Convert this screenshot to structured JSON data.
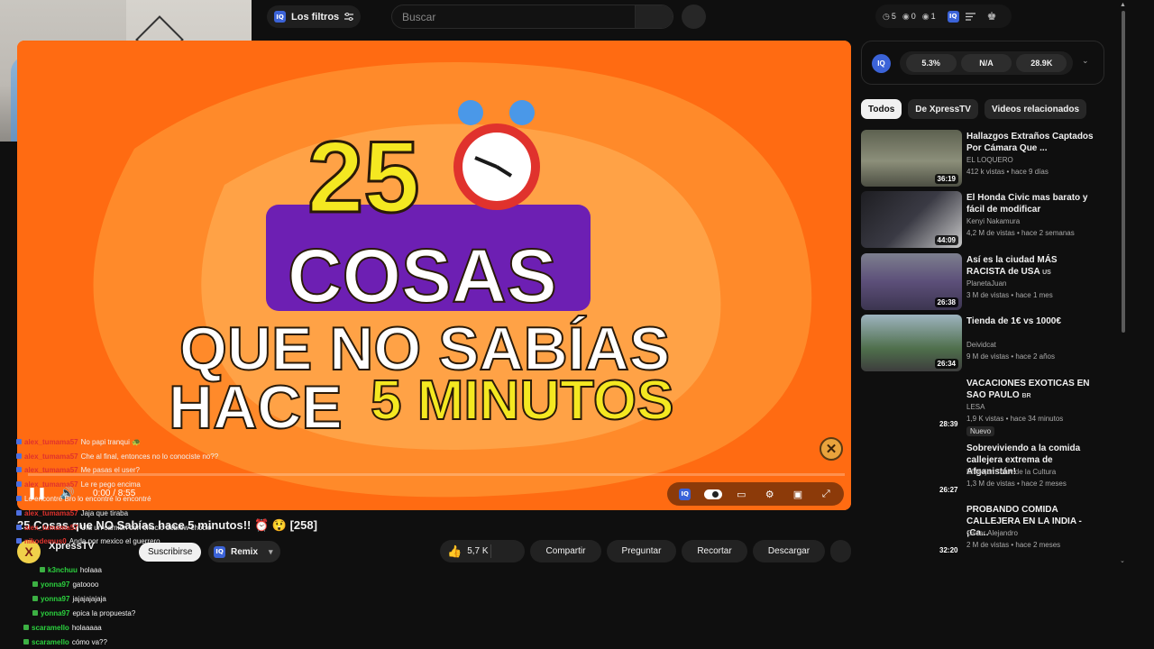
{
  "topbar": {
    "filters_label": "Los filtros",
    "iq_text": "IQ",
    "search_placeholder": "Buscar",
    "stats": [
      {
        "icon": "clock-icon",
        "value": "5"
      },
      {
        "icon": "eye-icon",
        "value": "0"
      },
      {
        "icon": "eye-icon",
        "value": "1"
      }
    ]
  },
  "player": {
    "thumbnail_text": {
      "number": "25",
      "line1": "COSAS",
      "line2": "QUE NO SABÍAS",
      "line3_white": "HACE",
      "line3_yellow": "5 MINUTOS"
    },
    "time": "0:00 / 8:55",
    "progress_fraction": 0,
    "colors": {
      "background": "#ff6b12",
      "yellow": "#f4e821",
      "purple": "#6d1fb3"
    }
  },
  "video": {
    "title": "25 Cosas que NO Sabías hace 5 minutos!! ⏰ 😲 [258]",
    "channel": "XpressTV",
    "subscribe_label": "Suscribirse",
    "remix_label": "Remix",
    "likes": "5,7 K",
    "actions": {
      "share": "Compartir",
      "ask": "Preguntar",
      "clip": "Recortar",
      "download": "Descargar"
    }
  },
  "chat": [
    {
      "user": "alex_tumama57",
      "msg": "No papi tranqui 🐢",
      "color": "#e0322d"
    },
    {
      "user": "alex_tumama57",
      "msg": "Che al final, entonces no lo conociste no??",
      "color": "#e0322d"
    },
    {
      "user": "alex_tumama57",
      "msg": "Me pasas el user?",
      "color": "#e0322d"
    },
    {
      "user": "alex_tumama57",
      "msg": "Le re pego encima",
      "color": "#e0322d"
    },
    {
      "user": "",
      "msg": "Lo encontré Bro lo encontré lo encontré",
      "color": "#e0322d"
    },
    {
      "user": "alex_tumama57",
      "msg": "Jaja que tiraba",
      "color": "#e0322d"
    },
    {
      "user": "alex_tumama57",
      "msg": "Ufa un camion con choclo deblew choclo",
      "color": "#e0322d"
    },
    {
      "user": "nikodemus0",
      "msg": "Anda por mexico el guerrero",
      "color": "#e0322d"
    },
    {
      "user": "k3nchuu",
      "msg": "holaaa",
      "color": "#2bd13e"
    },
    {
      "user": "yonna97",
      "msg": "gatoooo",
      "color": "#2bd13e"
    },
    {
      "user": "yonna97",
      "msg": "jajajajajaja",
      "color": "#2bd13e"
    },
    {
      "user": "yonna97",
      "msg": "epica la propuesta?",
      "color": "#2bd13e"
    },
    {
      "user": "scaramello",
      "msg": "holaaaaa",
      "color": "#2bd13e"
    },
    {
      "user": "scaramello",
      "msg": "cómo va??",
      "color": "#2bd13e"
    }
  ],
  "rating": {
    "iq_text": "IQ",
    "values": [
      "5.3%",
      "N/A",
      "28.9K"
    ]
  },
  "chips": [
    "Todos",
    "De XpressTV",
    "Videos relacionados"
  ],
  "recommendations": [
    {
      "title": "Hallazgos Extraños Captados Por Cámara Que ...",
      "tag": "",
      "channel": "EL LOQUERO",
      "meta": "412 k vistas • hace 9 días",
      "duration": "36:19",
      "thumb": "tunnel",
      "badge": ""
    },
    {
      "title": "El Honda Civic mas barato y fácil de modificar",
      "tag": "",
      "channel": "Kenyi Nakamura",
      "meta": "4,2 M de vistas • hace 2 semanas",
      "duration": "44:09",
      "thumb": "car",
      "badge": ""
    },
    {
      "title": "Así es la ciudad MÁS RACISTA de USA",
      "tag": "US",
      "channel": "PlanetaJuan",
      "meta": "3 M de vistas • hace 1 mes",
      "duration": "26:38",
      "thumb": "city",
      "badge": ""
    },
    {
      "title": "Tienda de 1€ vs 1000€",
      "tag": "",
      "channel": "Deividcat",
      "meta": "9 M de vistas • hace 2 años",
      "duration": "26:34",
      "thumb": "tent",
      "badge": ""
    },
    {
      "title": "VACACIONES EXOTICAS EN SAO PAULO",
      "tag": "BR",
      "channel": "LESA",
      "meta": "1,9 K vistas • hace 34 minutos",
      "duration": "28:39",
      "thumb": "",
      "badge": "Nuevo"
    },
    {
      "title": "Sobreviviendo a la comida callejera extrema de Afganistán!",
      "tag": "",
      "channel": "El Mejor Show de la Cultura",
      "meta": "1,3 M de vistas • hace 2 meses",
      "duration": "26:27",
      "thumb": "",
      "badge": ""
    },
    {
      "title": "PROBANDO COMIDA CALLEJERA EN LA INDIA - ¡Ca...",
      "tag": "",
      "channel": "Oscar Alejandro",
      "meta": "2 M de vistas • hace 2 meses",
      "duration": "32:20",
      "thumb": "",
      "badge": ""
    }
  ]
}
